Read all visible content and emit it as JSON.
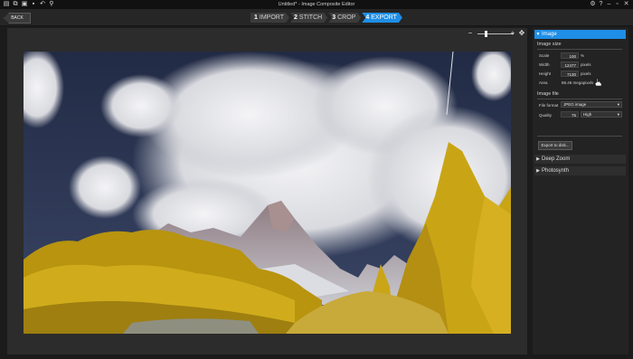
{
  "window": {
    "title": "Untitled* - Image Composite Editor",
    "controls": [
      "⚙",
      "?",
      "–",
      "▫",
      "✕"
    ]
  },
  "toolbar": {
    "back_label": "BACK",
    "steps": [
      {
        "num": "1",
        "label": "IMPORT"
      },
      {
        "num": "2",
        "label": "STITCH"
      },
      {
        "num": "3",
        "label": "CROP"
      },
      {
        "num": "4",
        "label": "EXPORT"
      }
    ],
    "active_step": "4"
  },
  "zoom": {
    "minus": "−",
    "plus": "+",
    "fit": "✥"
  },
  "panel": {
    "image_section": "Image",
    "image_size_label": "Image size",
    "scale_label": "Scale",
    "scale_value": "100",
    "scale_unit": "%",
    "width_label": "Width",
    "width_value": "12477",
    "width_unit": "pixels",
    "height_label": "Height",
    "height_value": "7130",
    "height_unit": "pixels",
    "area_label": "Area",
    "area_value": "88.46 megapixels",
    "image_file_label": "Image file",
    "format_label": "File format",
    "format_value": "JPEG image",
    "quality_label": "Quality",
    "quality_value": "75",
    "quality_level": "High",
    "export_button": "Export to disk...",
    "deep_zoom_section": "Deep Zoom",
    "photosynth_section": "Photosynth"
  },
  "colors": {
    "accent": "#1e8ee6",
    "foliage": "#c9a516",
    "sky": "#2a3553"
  }
}
